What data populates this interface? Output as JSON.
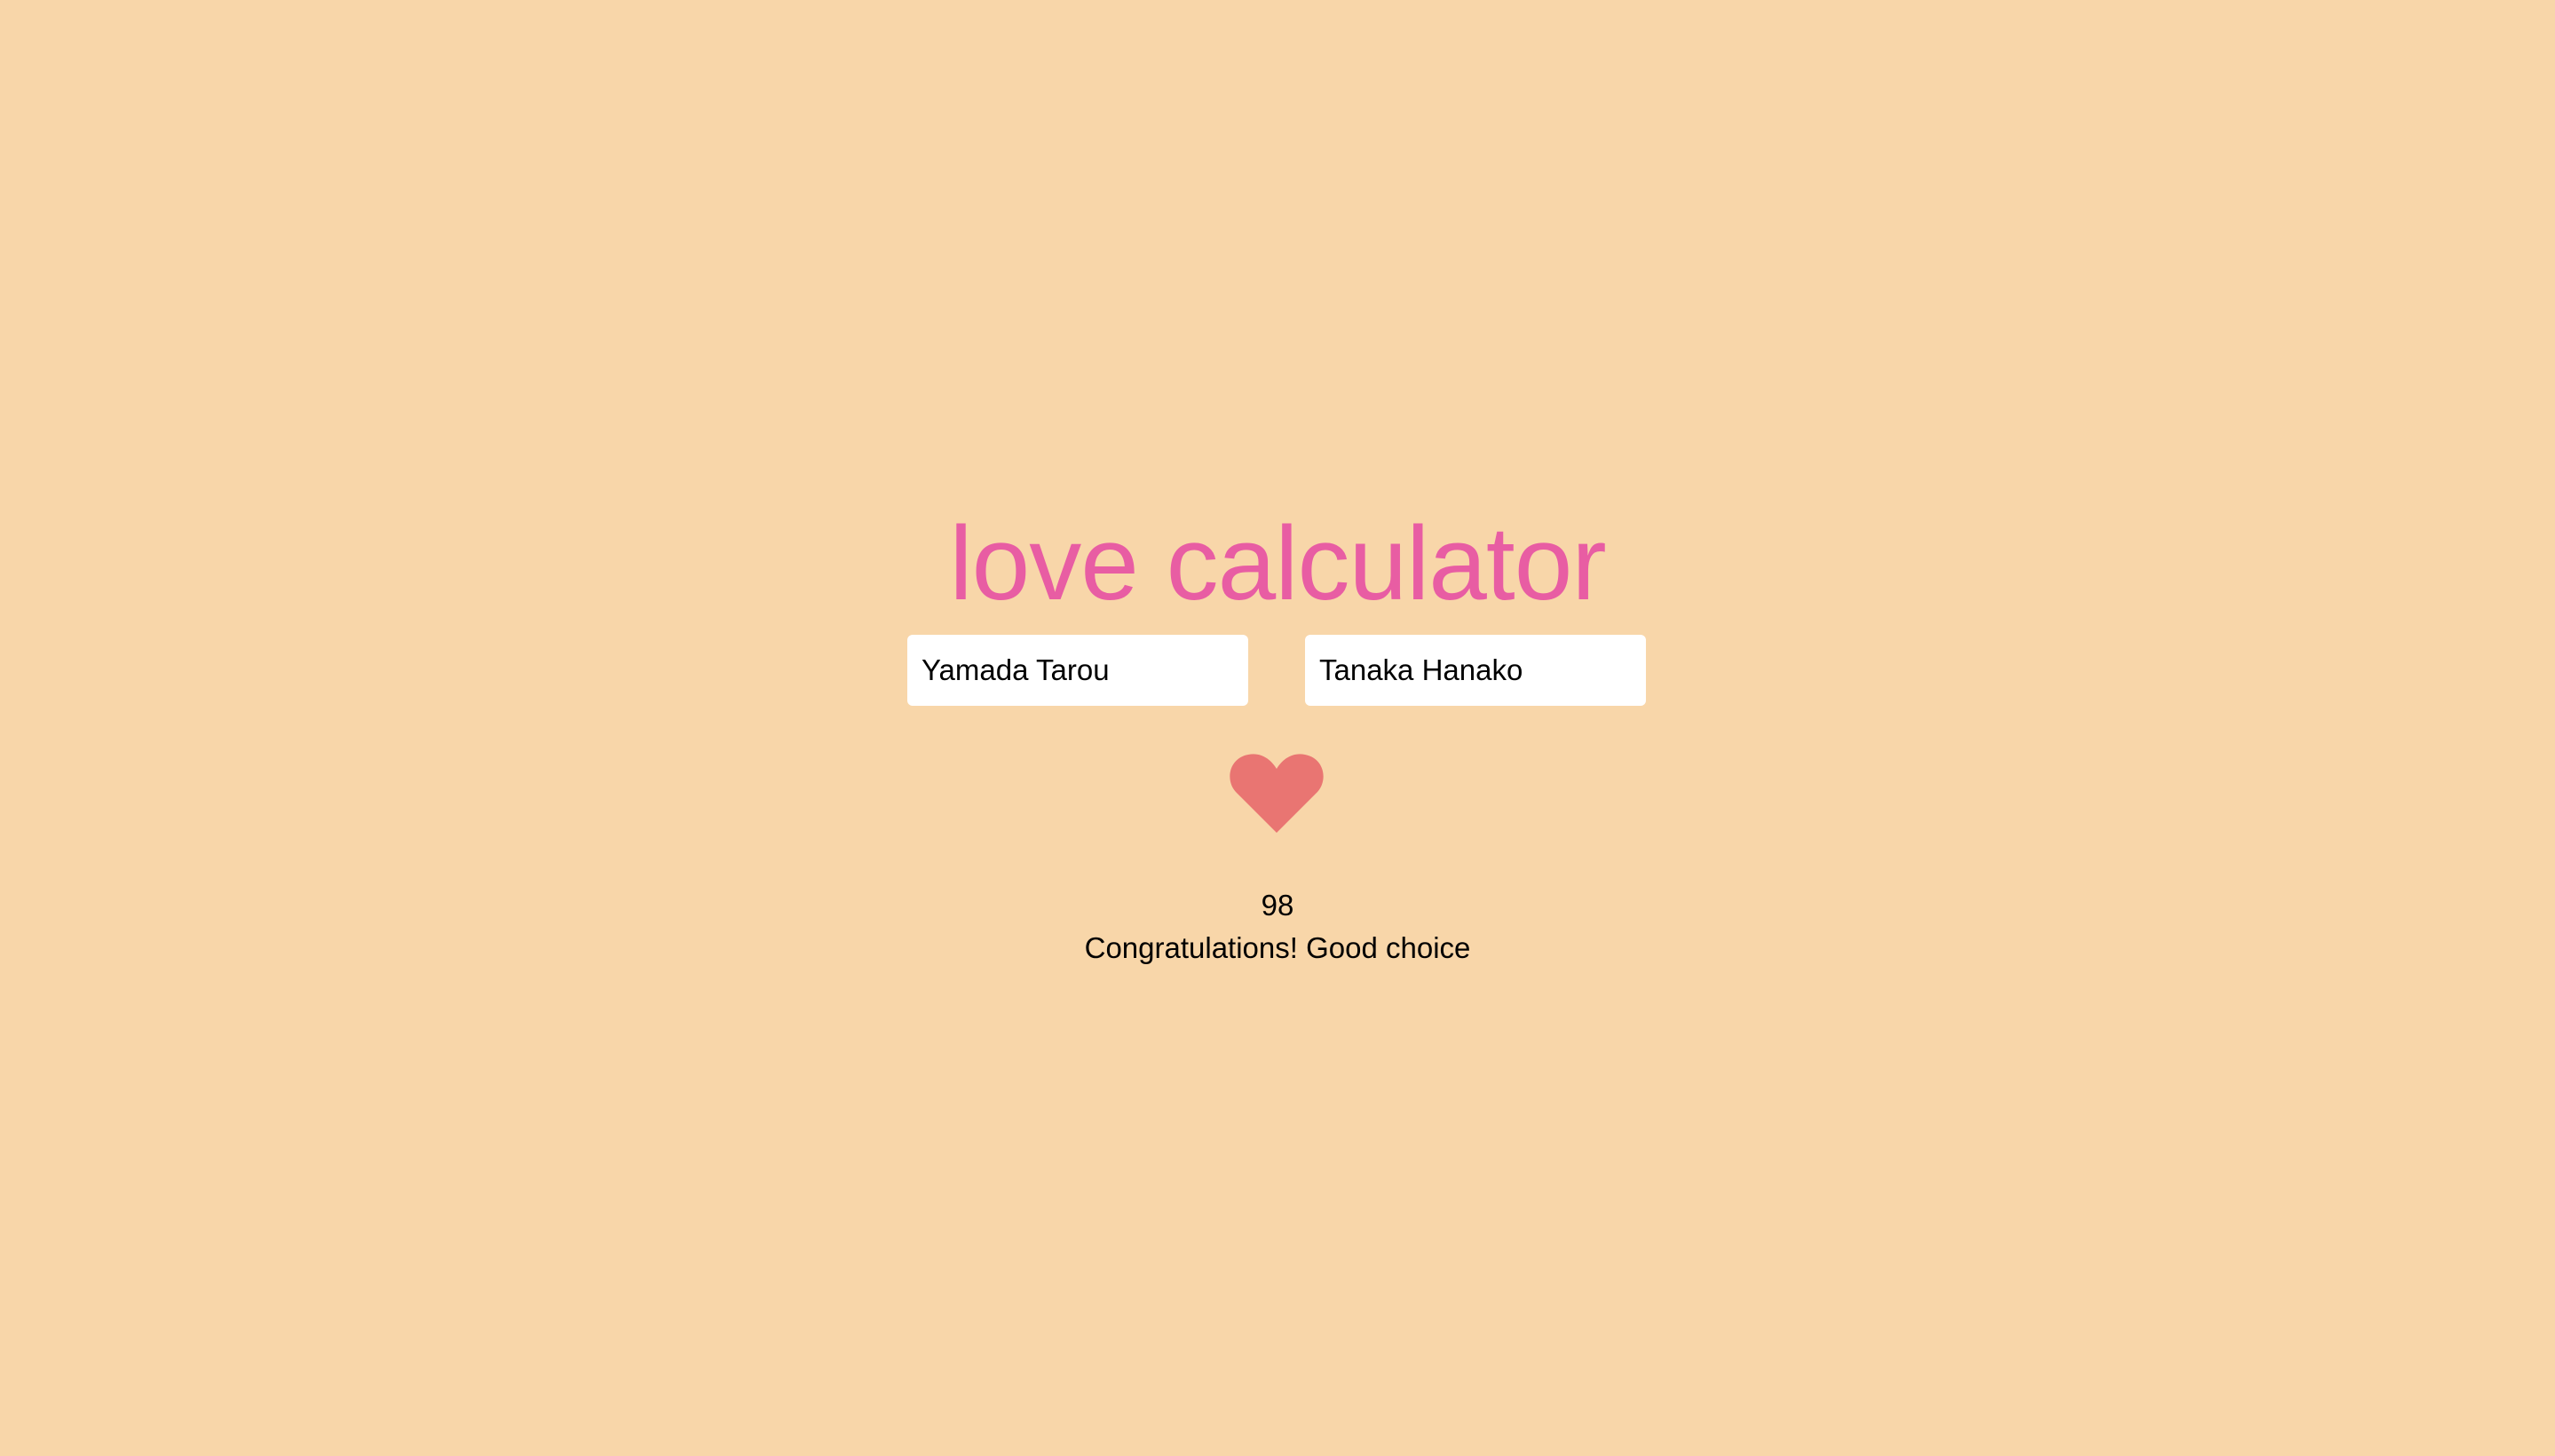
{
  "page": {
    "title": "love calculator"
  },
  "inputs": {
    "first_name": {
      "value": "Yamada Tarou",
      "placeholder": ""
    },
    "second_name": {
      "value": "Tanaka Hanako",
      "placeholder": ""
    }
  },
  "result": {
    "score": "98",
    "message": "Congratulations! Good choice"
  },
  "icons": {
    "heart": "heart-icon"
  },
  "colors": {
    "background": "#f8d6a9",
    "title": "#e85da3",
    "heart": "#e97572",
    "input_background": "#ffffff",
    "text": "#000000"
  }
}
